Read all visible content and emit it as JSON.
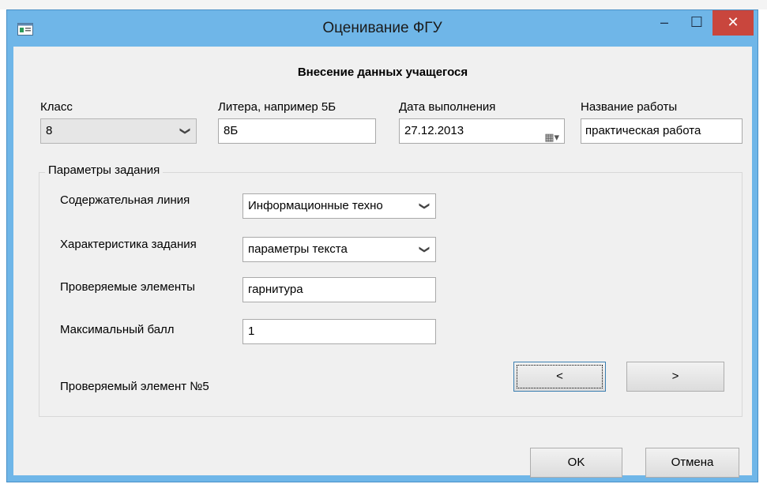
{
  "window": {
    "title": "Оценивание ФГУ",
    "minimize": "–",
    "maximize": "☐",
    "close": "✕"
  },
  "form": {
    "heading": "Внесение данных учащегося",
    "class_label": "Класс",
    "class_value": "8",
    "letter_label": "Литера, например 5Б",
    "letter_value": "8Б",
    "date_label": "Дата выполнения",
    "date_value": "27.12.2013",
    "work_label": "Название работы",
    "work_value": "практическая работа"
  },
  "params": {
    "group_title": "Параметры задания",
    "line_label": "Содержательная линия",
    "line_value": "Информационные техно",
    "char_label": "Характеристика задания",
    "char_value": "параметры текста",
    "elements_label": "Проверяемые элементы",
    "elements_value": "гарнитура",
    "max_label": "Максимальный балл",
    "max_value": "1",
    "counter": "Проверяемый элемент №5",
    "prev": "<",
    "next": ">"
  },
  "buttons": {
    "ok": "OK",
    "cancel": "Отмена"
  },
  "icons": {
    "dropdown": "chevron-down-icon",
    "calendar": "calendar-icon",
    "app": "form-icon"
  }
}
